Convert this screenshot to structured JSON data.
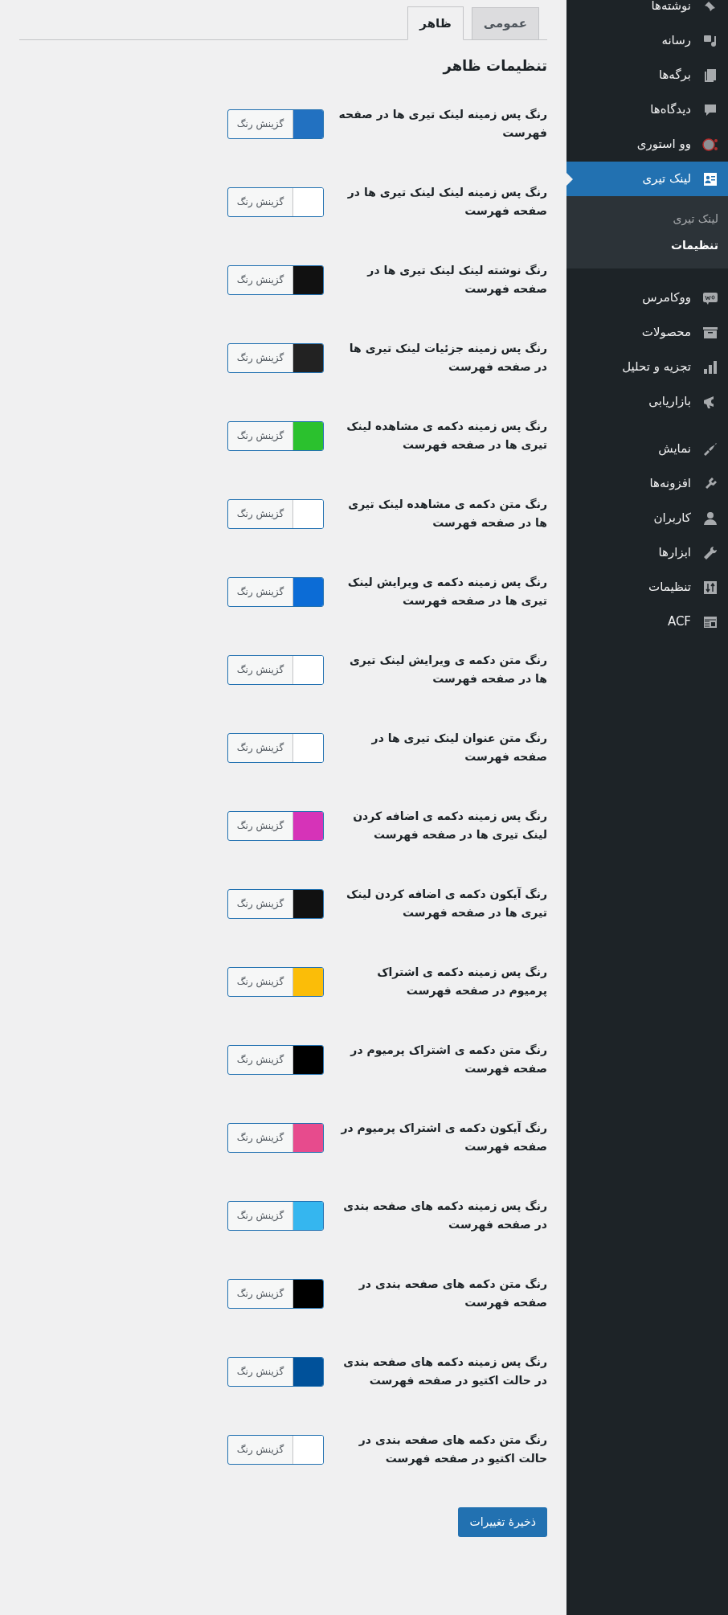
{
  "tabs": [
    {
      "label": "عمومی",
      "selected": false
    },
    {
      "label": "ظاهر",
      "selected": true
    }
  ],
  "heading": "تنظیمات ظاهر",
  "settings": [
    {
      "label": "رنگ پس زمینه لینک تیری ها در صفحه فهرست",
      "color": "#2271c1",
      "picker_label": "گزینش رنگ"
    },
    {
      "label": "رنگ پس زمینه لینک لینک تیری ها در صفحه فهرست",
      "color": "#ffffff",
      "picker_label": "گزینش رنگ"
    },
    {
      "label": "رنگ نوشته لینک لینک تیری ها در صفحه فهرست",
      "color": "#111111",
      "picker_label": "گزینش رنگ"
    },
    {
      "label": "رنگ پس زمینه جزئیات لینک تیری ها در صفحه فهرست",
      "color": "#222222",
      "picker_label": "گزینش رنگ"
    },
    {
      "label": "رنگ پس زمینه دکمه ی مشاهده لینک تیری ها در صفحه فهرست",
      "color": "#2bc12e",
      "picker_label": "گزینش رنگ"
    },
    {
      "label": "رنگ متن دکمه ی مشاهده لینک تیری ها در صفحه فهرست",
      "color": "#ffffff",
      "picker_label": "گزینش رنگ"
    },
    {
      "label": "رنگ پس زمینه دکمه ی ویرایش لینک تیری ها در صفحه فهرست",
      "color": "#0c6cd6",
      "picker_label": "گزینش رنگ"
    },
    {
      "label": "رنگ متن دکمه ی ویرایش لینک تیری ها در صفحه فهرست",
      "color": "#ffffff",
      "picker_label": "گزینش رنگ"
    },
    {
      "label": "رنگ متن عنوان لینک تیری ها در صفحه فهرست",
      "color": "#ffffff",
      "picker_label": "گزینش رنگ"
    },
    {
      "label": "رنگ پس زمینه دکمه ی اضافه کردن لینک تیری ها در صفحه فهرست",
      "color": "#d633b8",
      "picker_label": "گزینش رنگ"
    },
    {
      "label": "رنگ آیکون دکمه ی اضافه کردن لینک تیری ها در صفحه فهرست",
      "color": "#111111",
      "picker_label": "گزینش رنگ"
    },
    {
      "label": "رنگ پس زمینه دکمه ی اشتراک پرمیوم در صفحه فهرست",
      "color": "#fbbd08",
      "picker_label": "گزینش رنگ"
    },
    {
      "label": "رنگ متن دکمه ی اشتراک پرمیوم در صفحه فهرست",
      "color": "#000000",
      "picker_label": "گزینش رنگ"
    },
    {
      "label": "رنگ آیکون دکمه ی اشتراک پرمیوم در صفحه فهرست",
      "color": "#e74b8d",
      "picker_label": "گزینش رنگ"
    },
    {
      "label": "رنگ پس زمینه دکمه های صفحه بندی در صفحه فهرست",
      "color": "#35b6ef",
      "picker_label": "گزینش رنگ"
    },
    {
      "label": "رنگ متن دکمه های صفحه بندی در صفحه فهرست",
      "color": "#000000",
      "picker_label": "گزینش رنگ"
    },
    {
      "label": "رنگ پس زمینه دکمه های صفحه بندی در حالت اکتیو در صفحه فهرست",
      "color": "#00519a",
      "picker_label": "گزینش رنگ"
    },
    {
      "label": "رنگ متن دکمه های صفحه بندی در حالت اکتیو در صفحه فهرست",
      "color": "#ffffff",
      "picker_label": "گزینش رنگ"
    }
  ],
  "save_button": "ذخیرهٔ تغییرات",
  "sidebar": {
    "sections": [
      {
        "items": [
          {
            "label": "نوشته‌ها",
            "selected": false
          },
          {
            "label": "رسانه",
            "selected": false
          },
          {
            "label": "برگه‌ها",
            "selected": false
          },
          {
            "label": "دیدگاه‌ها",
            "selected": false
          },
          {
            "label": "وو استوری",
            "selected": false
          },
          {
            "label": "لینک تیری",
            "selected": true,
            "children": [
              {
                "label": "لینک تیری",
                "selected": false
              },
              {
                "label": "تنظیمات",
                "selected": true
              }
            ]
          },
          {
            "label": "ووکامرس",
            "selected": false
          },
          {
            "label": "محصولات",
            "selected": false
          },
          {
            "label": "تجزیه و تحلیل",
            "selected": false
          },
          {
            "label": "بازاریابی",
            "selected": false
          }
        ]
      },
      {
        "items": [
          {
            "label": "نمایش",
            "selected": false
          },
          {
            "label": "افزونه‌ها",
            "selected": false
          },
          {
            "label": "کاربران",
            "selected": false
          },
          {
            "label": "ابزارها",
            "selected": false
          },
          {
            "label": "تنظیمات",
            "selected": false
          },
          {
            "label": "ACF",
            "selected": false
          }
        ]
      }
    ]
  }
}
